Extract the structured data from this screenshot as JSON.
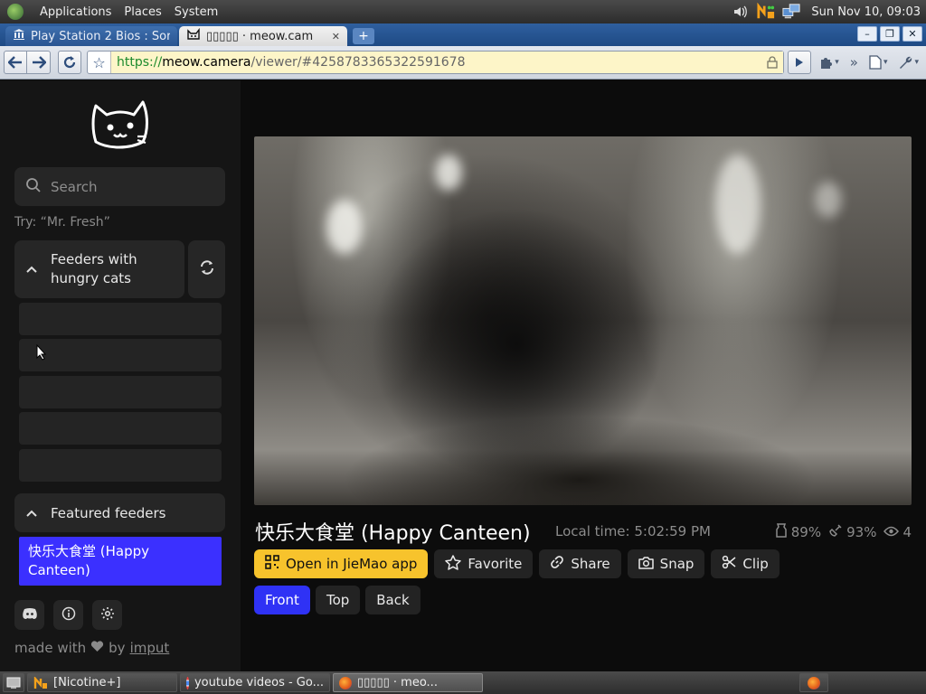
{
  "panel": {
    "menus": [
      "Applications",
      "Places",
      "System"
    ],
    "clock": "Sun Nov 10, 09:03"
  },
  "tabs": [
    {
      "title": "Play Station 2 Bios : Sor",
      "active": false
    },
    {
      "title": "▯▯▯▯▯ · meow.cam",
      "active": true
    }
  ],
  "toolbar": {
    "url_scheme": "https://",
    "url_host": "meow.camera",
    "url_path": "/viewer/#4258783365322591678"
  },
  "sidebar": {
    "search_placeholder": "Search",
    "hint": "Try: “Mr. Fresh”",
    "section_hungry": "Feeders with hungry cats",
    "section_featured": "Featured feeders",
    "featured_items": [
      "快乐大食堂 (Happy Canteen)"
    ],
    "made_with": "made with",
    "by": "by",
    "author": "imput"
  },
  "camera": {
    "title": "快乐大食堂 (Happy Canteen)",
    "local_time": "Local time: 5:02:59 PM",
    "food": "89%",
    "signal": "93%",
    "viewers": "4"
  },
  "actions": {
    "open_app": "Open in JieMao app",
    "favorite": "Favorite",
    "share": "Share",
    "snap": "Snap",
    "clip": "Clip"
  },
  "views": {
    "front": "Front",
    "top": "Top",
    "back": "Back",
    "active": "front"
  },
  "taskbar": {
    "items": [
      "[Nicotine+]",
      "youtube videos - Go...",
      "▯▯▯▯▯ · meo..."
    ]
  },
  "colors": {
    "accent_blue": "#3b30ff",
    "primary_yellow": "#f7c32c",
    "sidebar_bg": "#151515",
    "page_bg": "#0c0c0c"
  }
}
